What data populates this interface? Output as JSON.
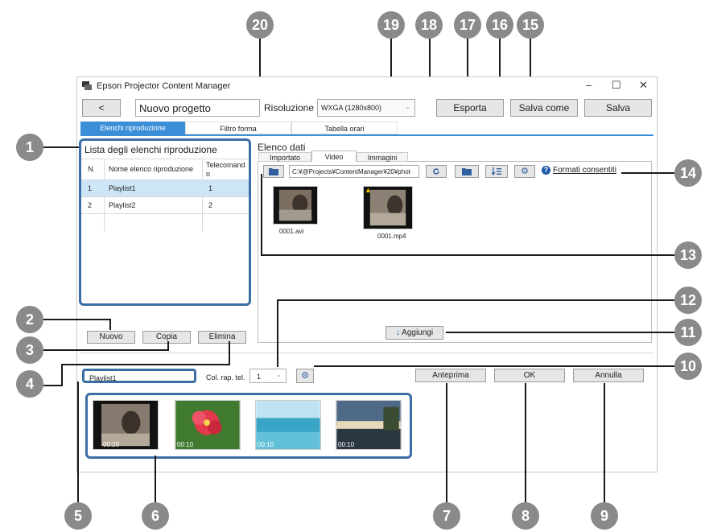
{
  "window": {
    "title": "Epson Projector Content Manager",
    "minimize": "–",
    "maximize": "☐",
    "close": "✕"
  },
  "toolbar": {
    "back": "<",
    "project_name": "Nuovo progetto",
    "resolution_label": "Risoluzione :",
    "resolution_value": "WXGA (1280x800)",
    "export": "Esporta",
    "save_as": "Salva come",
    "save": "Salva"
  },
  "main_tabs": [
    "Elenchi riproduzione",
    "Filtro forma",
    "Tabella orari"
  ],
  "playlists": {
    "heading": "Lista degli elenchi riproduzione",
    "columns": [
      "N.",
      "Nome elenco riproduzione",
      "Telecomando"
    ],
    "rows": [
      {
        "n": "1",
        "name": "Playlist1",
        "remote": "1"
      },
      {
        "n": "2",
        "name": "Playlist2",
        "remote": "2"
      }
    ],
    "new": "Nuovo",
    "copy": "Copia",
    "delete": "Elimina"
  },
  "data_list": {
    "heading": "Elenco dati",
    "tabs": [
      "Importato",
      "Video",
      "Immagini"
    ],
    "path": "C:¥@Projects¥ContentManager¥20¥phot",
    "formats_link": "Formati consentiti",
    "files": [
      {
        "name": "0001.avi",
        "warning": false
      },
      {
        "name": "0001.mp4",
        "warning": true
      }
    ],
    "add": "Aggiungi"
  },
  "editor": {
    "playlist_name": "Playlist1",
    "remote_label": "Col. rap. tel.",
    "remote_value": "1",
    "preview": "Anteprima",
    "ok": "OK",
    "cancel": "Annulla",
    "clips": [
      {
        "duration": "00:20",
        "kind": "video"
      },
      {
        "duration": "00:10",
        "kind": "flower"
      },
      {
        "duration": "00:10",
        "kind": "sea"
      },
      {
        "duration": "00:10",
        "kind": "sunset"
      }
    ]
  },
  "callouts": [
    "1",
    "2",
    "3",
    "4",
    "5",
    "6",
    "7",
    "8",
    "9",
    "10",
    "11",
    "12",
    "13",
    "14",
    "15",
    "16",
    "17",
    "18",
    "19",
    "20"
  ],
  "colors": {
    "accent": "#3a8fd8",
    "selection": "#cde6f7",
    "highlight_box": "#3b6ea5",
    "callout": "#8a8a8a",
    "warning": "#f2c200"
  }
}
